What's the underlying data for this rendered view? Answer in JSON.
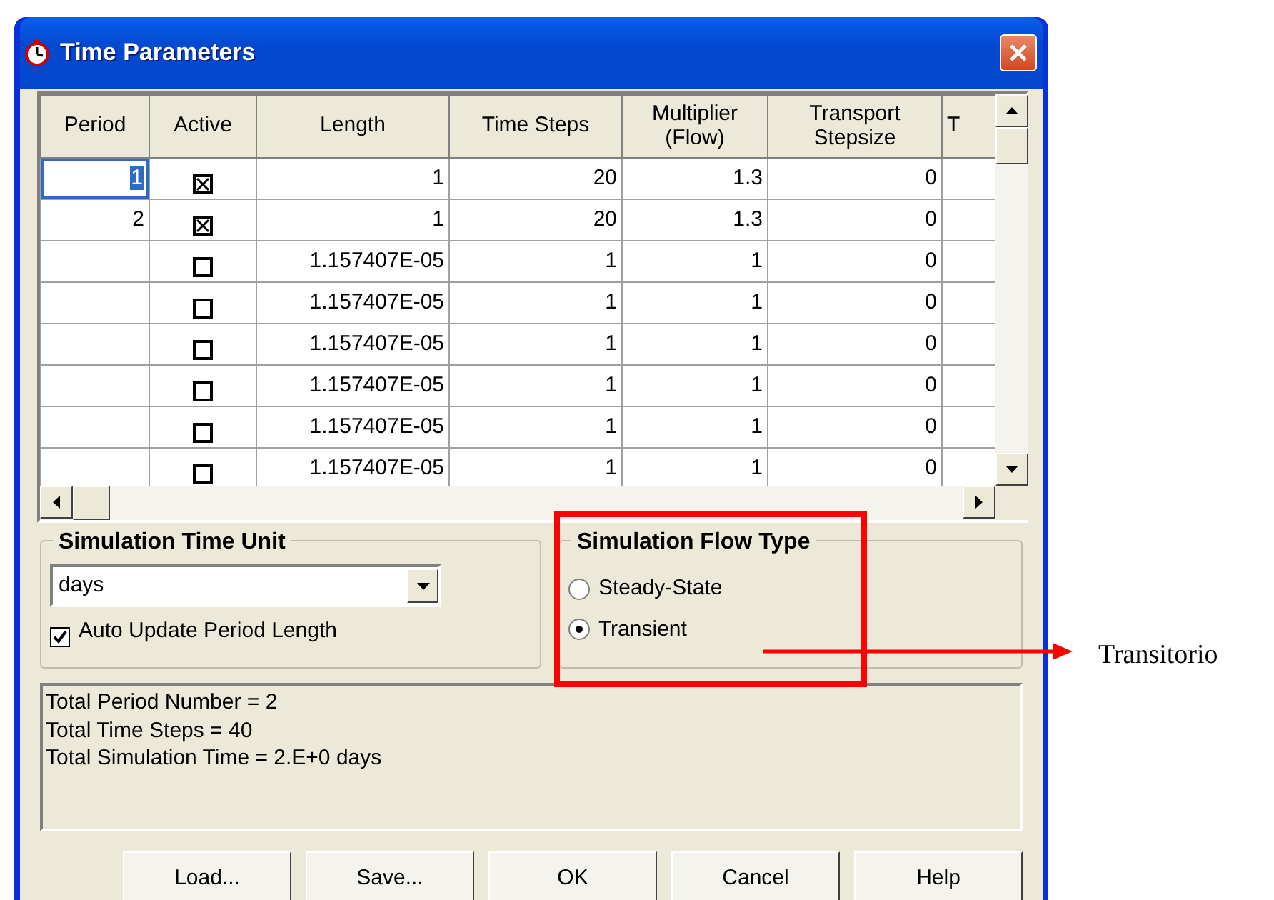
{
  "window": {
    "title": "Time Parameters"
  },
  "table": {
    "columns": [
      "Period",
      "Active",
      "Length",
      "Time Steps",
      "Multiplier (Flow)",
      "Transport Stepsize",
      "T"
    ],
    "rows": [
      {
        "period": "1",
        "selected": true,
        "checked": true,
        "length": "1",
        "time_steps": "20",
        "multiplier": "1.3",
        "transport": "0"
      },
      {
        "period": "2",
        "selected": false,
        "checked": true,
        "length": "1",
        "time_steps": "20",
        "multiplier": "1.3",
        "transport": "0"
      },
      {
        "selected": false,
        "checked": false,
        "length": "1.157407E-05",
        "time_steps": "1",
        "multiplier": "1",
        "transport": "0"
      },
      {
        "selected": false,
        "checked": false,
        "length": "1.157407E-05",
        "time_steps": "1",
        "multiplier": "1",
        "transport": "0"
      },
      {
        "selected": false,
        "checked": false,
        "length": "1.157407E-05",
        "time_steps": "1",
        "multiplier": "1",
        "transport": "0"
      },
      {
        "selected": false,
        "checked": false,
        "length": "1.157407E-05",
        "time_steps": "1",
        "multiplier": "1",
        "transport": "0"
      },
      {
        "selected": false,
        "checked": false,
        "length": "1.157407E-05",
        "time_steps": "1",
        "multiplier": "1",
        "transport": "0"
      },
      {
        "selected": false,
        "checked": false,
        "length": "1.157407E-05",
        "time_steps": "1",
        "multiplier": "1",
        "transport": "0"
      }
    ]
  },
  "time_unit": {
    "label": "Simulation Time Unit",
    "value": "days",
    "auto_update": {
      "label": "Auto Update Period Length",
      "checked": true
    }
  },
  "flow_type": {
    "label": "Simulation Flow Type",
    "options": [
      {
        "label": "Steady-State",
        "selected": false
      },
      {
        "label": "Transient",
        "selected": true
      }
    ]
  },
  "summary": [
    "Total Period Number = 2",
    "Total Time Steps = 40",
    "Total Simulation Time = 2.E+0 days"
  ],
  "buttons": [
    "Load...",
    "Save...",
    "OK",
    "Cancel",
    "Help"
  ],
  "annotation": {
    "label": "Transitorio"
  }
}
